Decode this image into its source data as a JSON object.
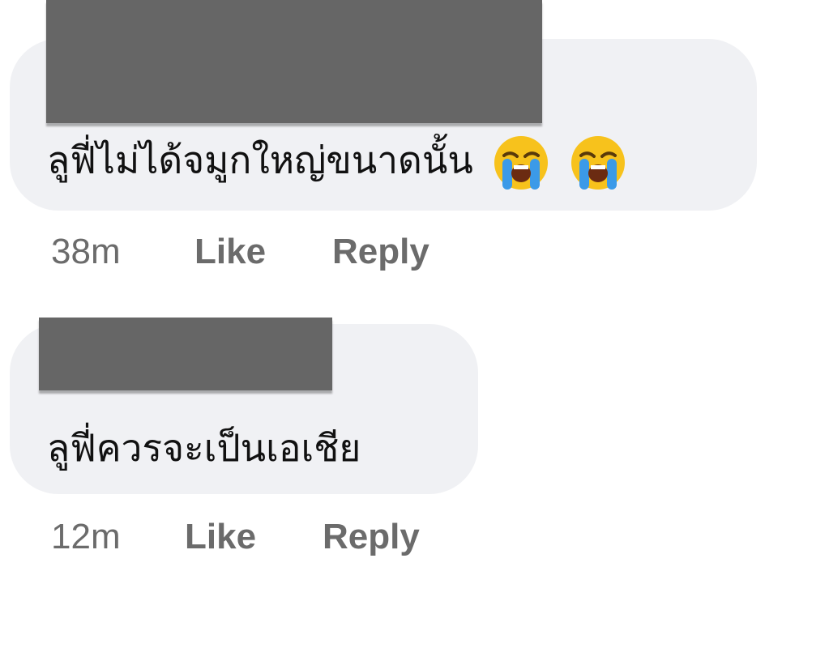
{
  "comments": [
    {
      "text": "ลูฟี่ไม่ได้จมูกใหญ่ขนาดนั้น",
      "emojis": [
        "loudly-crying-face-icon",
        "loudly-crying-face-icon"
      ],
      "time": "38m",
      "like_label": "Like",
      "reply_label": "Reply"
    },
    {
      "text": "ลูฟี่ควรจะเป็นเอเชีย",
      "time": "12m",
      "like_label": "Like",
      "reply_label": "Reply"
    }
  ],
  "colors": {
    "bubble": "#f0f1f4",
    "redaction": "#666666",
    "meta_text": "#6b6b6b",
    "comment_text": "#111111"
  }
}
